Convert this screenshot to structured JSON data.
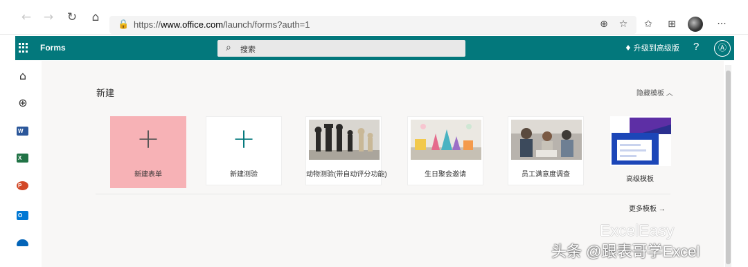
{
  "browser": {
    "back_icon": "←",
    "forward_icon": "→",
    "refresh_icon": "↻",
    "home_icon": "⌂",
    "lock_icon": "🔒",
    "url_prefix": "https://",
    "url_host": "www.office.com",
    "url_path": "/launch/forms?auth=1",
    "add_icon": "⊕",
    "favorite_icon": "☆",
    "favorites_icon": "✩",
    "collections_icon": "⊞",
    "more_icon": "···"
  },
  "app": {
    "title": "Forms",
    "search_placeholder": "搜索",
    "search_icon": "⌕",
    "upgrade_icon": "♦",
    "upgrade_label": "升级到高级版",
    "help_label": "?",
    "account_icon": "Ⓐ"
  },
  "rail": {
    "home_icon": "⌂",
    "create_icon": "⊕",
    "word": "W",
    "excel": "X",
    "powerpoint": "P",
    "outlook": "O"
  },
  "main": {
    "section_title": "新建",
    "hide_templates": "隐藏模板 ︿",
    "more_templates": "更多模板 →",
    "cards": [
      {
        "label": "新建表单",
        "plus": "+"
      },
      {
        "label": "新建测验",
        "plus": "+"
      },
      {
        "label": "动物测验(带自动评分功能)"
      },
      {
        "label": "生日聚会邀请"
      },
      {
        "label": "员工满意度调查"
      },
      {
        "label": "高级模板"
      }
    ]
  },
  "watermark": {
    "top": "ExcelEasy",
    "bottom": "头条 @跟表哥学Excel"
  },
  "colors": {
    "brand": "#03787c",
    "selected_card": "#f7b2b6"
  }
}
